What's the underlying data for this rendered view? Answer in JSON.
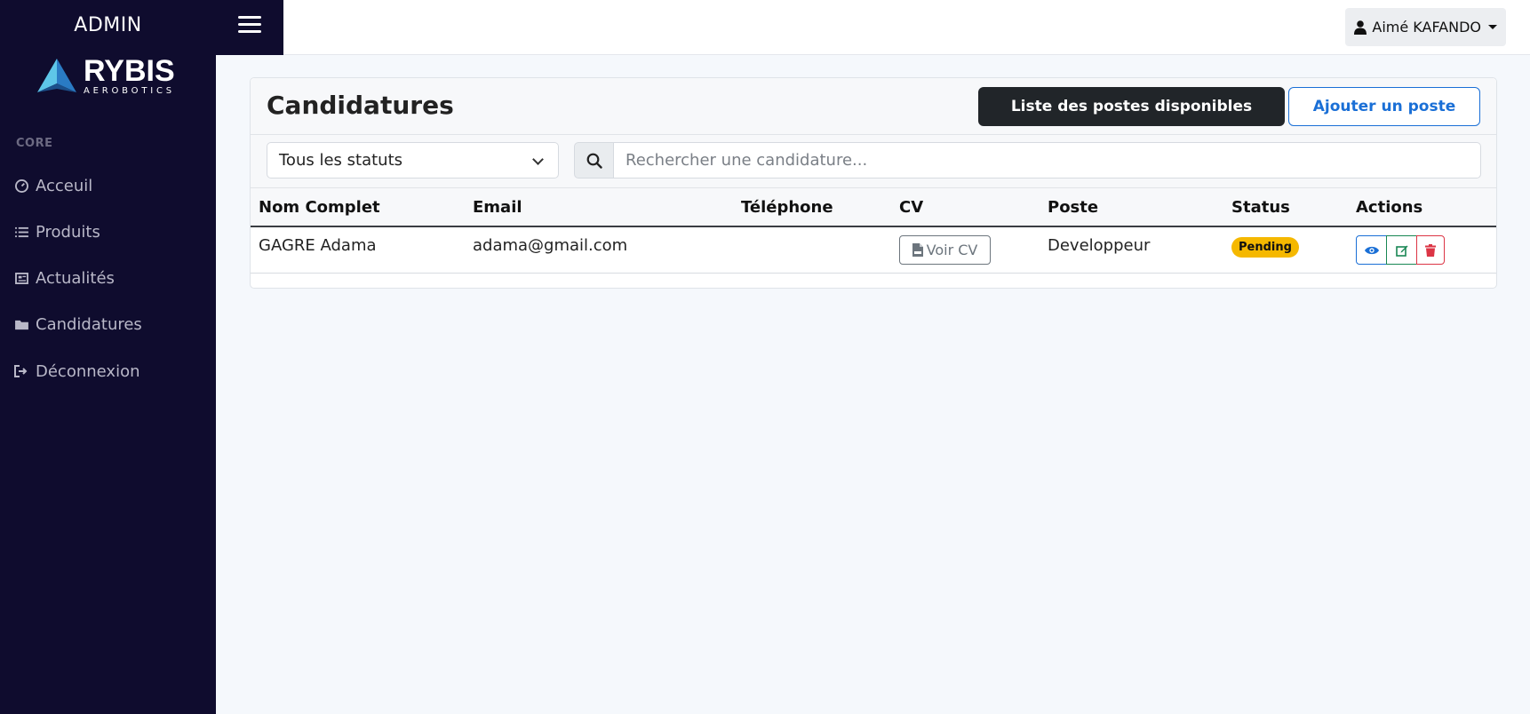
{
  "header": {
    "brand_title": "ADMIN",
    "user_name": "Aimé KAFANDO"
  },
  "logo": {
    "main": "RYBIS",
    "sub": "AEROBOTICS"
  },
  "sidebar": {
    "heading": "CORE",
    "items": [
      {
        "label": "Acceuil",
        "icon": "dashboard-icon"
      },
      {
        "label": "Produits",
        "icon": "list-icon"
      },
      {
        "label": "Actualités",
        "icon": "newspaper-icon"
      },
      {
        "label": "Candidatures",
        "icon": "folder-icon"
      },
      {
        "label": "Déconnexion",
        "icon": "logout-icon"
      }
    ]
  },
  "main": {
    "title": "Candidatures",
    "btn_list_label": "Liste des postes disponibles",
    "btn_add_label": "Ajouter un poste",
    "status_filter_value": "Tous les statuts",
    "search_placeholder": "Rechercher une candidature..."
  },
  "table": {
    "headers": [
      "Nom Complet",
      "Email",
      "Téléphone",
      "CV",
      "Poste",
      "Status",
      "Actions"
    ],
    "rows": [
      {
        "name": "GAGRE Adama",
        "email": "adama@gmail.com",
        "phone": "",
        "cv_label": "Voir CV",
        "poste": "Developpeur",
        "status": "Pending"
      }
    ]
  },
  "colors": {
    "sidebar_bg": "#0f0c2e",
    "primary": "#1a6fd6",
    "success": "#198754",
    "danger": "#dc3545",
    "warning": "#f5b800"
  }
}
